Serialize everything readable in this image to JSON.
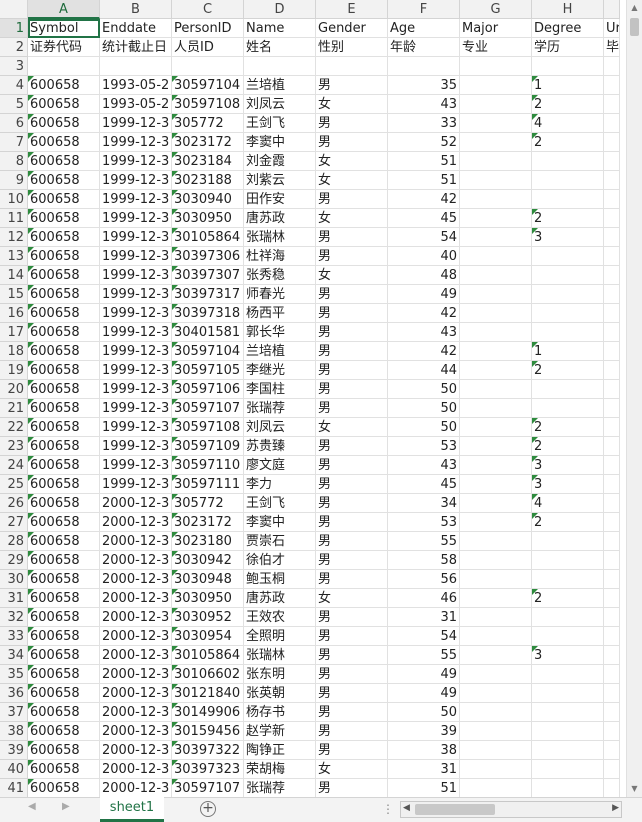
{
  "columns": [
    "A",
    "B",
    "C",
    "D",
    "E",
    "F",
    "G",
    "H",
    ""
  ],
  "active_col": "A",
  "active_row": "1",
  "header_row": [
    "Symbol",
    "Enddate",
    "PersonID",
    "Name",
    "Gender",
    "Age",
    "Major",
    "Degree",
    "Ur"
  ],
  "label_row": [
    "证券代码",
    "统计截止日",
    "人员ID",
    "姓名",
    "性别",
    "年龄",
    "专业",
    "学历",
    "毕"
  ],
  "data_rows": [
    [
      "600658",
      "1993-05-2",
      "30597104",
      "兰培植",
      "男",
      "35",
      "",
      "1"
    ],
    [
      "600658",
      "1993-05-2",
      "30597108",
      "刘凤云",
      "女",
      "43",
      "",
      "2"
    ],
    [
      "600658",
      "1999-12-3",
      "305772",
      "王剑飞",
      "男",
      "33",
      "",
      "4"
    ],
    [
      "600658",
      "1999-12-3",
      "3023172",
      "李窦中",
      "男",
      "52",
      "",
      "2"
    ],
    [
      "600658",
      "1999-12-3",
      "3023184",
      "刘金霞",
      "女",
      "51",
      "",
      ""
    ],
    [
      "600658",
      "1999-12-3",
      "3023188",
      "刘紫云",
      "女",
      "51",
      "",
      ""
    ],
    [
      "600658",
      "1999-12-3",
      "3030940",
      "田作安",
      "男",
      "42",
      "",
      ""
    ],
    [
      "600658",
      "1999-12-3",
      "3030950",
      "唐苏政",
      "女",
      "45",
      "",
      "2"
    ],
    [
      "600658",
      "1999-12-3",
      "30105864",
      "张瑞林",
      "男",
      "54",
      "",
      "3"
    ],
    [
      "600658",
      "1999-12-3",
      "30397306",
      "杜祥海",
      "男",
      "40",
      "",
      ""
    ],
    [
      "600658",
      "1999-12-3",
      "30397307",
      "张秀稳",
      "女",
      "48",
      "",
      ""
    ],
    [
      "600658",
      "1999-12-3",
      "30397317",
      "师春光",
      "男",
      "49",
      "",
      ""
    ],
    [
      "600658",
      "1999-12-3",
      "30397318",
      "杨西平",
      "男",
      "42",
      "",
      ""
    ],
    [
      "600658",
      "1999-12-3",
      "30401581",
      "郭长华",
      "男",
      "43",
      "",
      ""
    ],
    [
      "600658",
      "1999-12-3",
      "30597104",
      "兰培植",
      "男",
      "42",
      "",
      "1"
    ],
    [
      "600658",
      "1999-12-3",
      "30597105",
      "李继光",
      "男",
      "44",
      "",
      "2"
    ],
    [
      "600658",
      "1999-12-3",
      "30597106",
      "李国柱",
      "男",
      "50",
      "",
      ""
    ],
    [
      "600658",
      "1999-12-3",
      "30597107",
      "张瑞荐",
      "男",
      "50",
      "",
      ""
    ],
    [
      "600658",
      "1999-12-3",
      "30597108",
      "刘凤云",
      "女",
      "50",
      "",
      "2"
    ],
    [
      "600658",
      "1999-12-3",
      "30597109",
      "苏贵臻",
      "男",
      "53",
      "",
      "2"
    ],
    [
      "600658",
      "1999-12-3",
      "30597110",
      "廖文庭",
      "男",
      "43",
      "",
      "3"
    ],
    [
      "600658",
      "1999-12-3",
      "30597111",
      "李力",
      "男",
      "45",
      "",
      "3"
    ],
    [
      "600658",
      "2000-12-3",
      "305772",
      "王剑飞",
      "男",
      "34",
      "",
      "4"
    ],
    [
      "600658",
      "2000-12-3",
      "3023172",
      "李窦中",
      "男",
      "53",
      "",
      "2"
    ],
    [
      "600658",
      "2000-12-3",
      "3023180",
      "贾崇石",
      "男",
      "55",
      "",
      ""
    ],
    [
      "600658",
      "2000-12-3",
      "3030942",
      "徐伯才",
      "男",
      "58",
      "",
      ""
    ],
    [
      "600658",
      "2000-12-3",
      "3030948",
      "鲍玉桐",
      "男",
      "56",
      "",
      ""
    ],
    [
      "600658",
      "2000-12-3",
      "3030950",
      "唐苏政",
      "女",
      "46",
      "",
      "2"
    ],
    [
      "600658",
      "2000-12-3",
      "3030952",
      "王效农",
      "男",
      "31",
      "",
      ""
    ],
    [
      "600658",
      "2000-12-3",
      "3030954",
      "全照明",
      "男",
      "54",
      "",
      ""
    ],
    [
      "600658",
      "2000-12-3",
      "30105864",
      "张瑞林",
      "男",
      "55",
      "",
      "3"
    ],
    [
      "600658",
      "2000-12-3",
      "30106602",
      "张东明",
      "男",
      "49",
      "",
      ""
    ],
    [
      "600658",
      "2000-12-3",
      "30121840",
      "张英朝",
      "男",
      "49",
      "",
      ""
    ],
    [
      "600658",
      "2000-12-3",
      "30149906",
      "杨存书",
      "男",
      "50",
      "",
      ""
    ],
    [
      "600658",
      "2000-12-3",
      "30159456",
      "赵学新",
      "男",
      "39",
      "",
      ""
    ],
    [
      "600658",
      "2000-12-3",
      "30397322",
      "陶铮正",
      "男",
      "38",
      "",
      ""
    ],
    [
      "600658",
      "2000-12-3",
      "30397323",
      "荣胡梅",
      "女",
      "31",
      "",
      ""
    ],
    [
      "600658",
      "2000-12-3",
      "30597107",
      "张瑞荐",
      "男",
      "51",
      "",
      ""
    ]
  ],
  "sheet_tab": "sheet1",
  "icons": {
    "add_sheet": "plus-circle-icon",
    "scroll_up": "triangle-up-icon",
    "scroll_down": "triangle-down-icon",
    "scroll_left": "triangle-left-icon",
    "scroll_right": "triangle-right-icon"
  },
  "colors": {
    "accent": "#217346",
    "error_triangle": "#2e8b3e",
    "header_bg": "#f2f2f2"
  }
}
